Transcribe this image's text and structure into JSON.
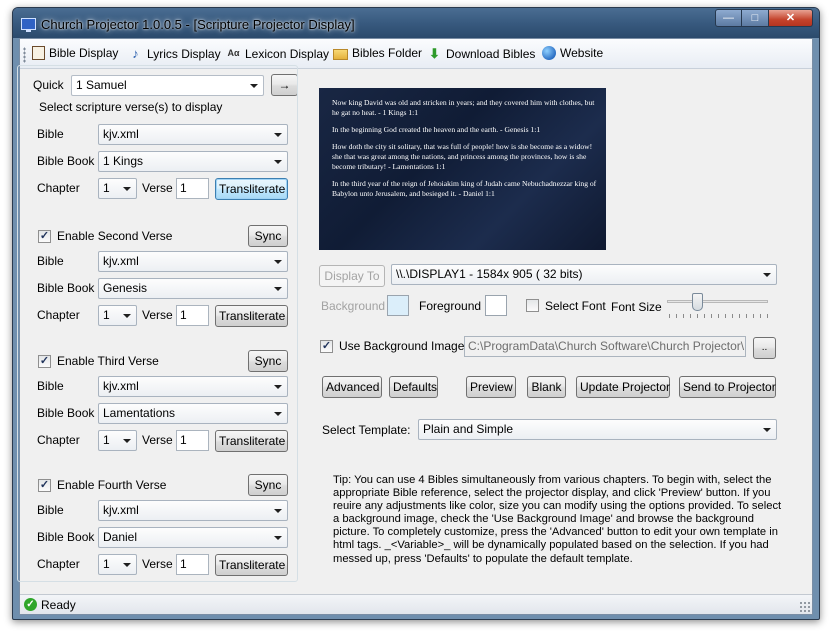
{
  "window": {
    "title": "Church Projector 1.0.0.5 - [Scripture Projector Display]",
    "controls": {
      "minimize": "—",
      "maximize": "□",
      "close": "✕"
    }
  },
  "menu": [
    {
      "label": "Bible Display",
      "icon": "bible-icon"
    },
    {
      "label": "Lyrics Display",
      "icon": "music-note-icon"
    },
    {
      "label": "Lexicon Display",
      "icon": "lexicon-icon"
    },
    {
      "label": "Bibles Folder",
      "icon": "folder-icon"
    },
    {
      "label": "Download Bibles",
      "icon": "download-icon"
    },
    {
      "label": "Website",
      "icon": "globe-icon"
    }
  ],
  "quick": {
    "label": "Quick",
    "value": "1 Samuel",
    "go_button": "→"
  },
  "group_title": "Select scripture verse(s) to display",
  "labels": {
    "bible": "Bible",
    "bible_book": "Bible Book",
    "chapter": "Chapter",
    "verse": "Verse"
  },
  "verses": [
    {
      "enable_label": "",
      "enabled": true,
      "bible": "kjv.xml",
      "book": "1 Kings",
      "chapter": "1",
      "verse": "1",
      "transliterate": "Transliterate",
      "sync": ""
    },
    {
      "enable_label": "Enable Second Verse",
      "enabled": true,
      "bible": "kjv.xml",
      "book": "Genesis",
      "chapter": "1",
      "verse": "1",
      "transliterate": "Transliterate",
      "sync": "Sync"
    },
    {
      "enable_label": "Enable Third Verse",
      "enabled": true,
      "bible": "kjv.xml",
      "book": "Lamentations",
      "chapter": "1",
      "verse": "1",
      "transliterate": "Transliterate",
      "sync": "Sync"
    },
    {
      "enable_label": "Enable Fourth Verse",
      "enabled": true,
      "bible": "kjv.xml",
      "book": "Daniel",
      "chapter": "1",
      "verse": "1",
      "transliterate": "Transliterate",
      "sync": "Sync"
    }
  ],
  "preview": [
    "Now king David was old and stricken in years; and they covered him with clothes, but he gat no heat. - 1 Kings 1:1",
    "In the beginning God created the heaven and the earth. - Genesis 1:1",
    "How doth the city sit solitary, that was full of people! how is she become as a widow! she that was great among the nations, and princess among the provinces, how is she become tributary! - Lamentations 1:1",
    "In the third year of the reign of Jehoiakim king of Judah came Nebuchadnezzar king of Babylon unto Jerusalem, and besieged it. - Daniel 1:1"
  ],
  "display": {
    "button": "Display To",
    "value": "\\\\.\\DISPLAY1 -  1584x 905 ( 32 bits)"
  },
  "appearance": {
    "background_label": "Background",
    "foreground_label": "Foreground",
    "select_font_label": "Select Font",
    "font_size_label": "Font Size",
    "background_color": "#dbeefa",
    "foreground_color": "#ffffff",
    "font_size_level": 0.28
  },
  "background_image": {
    "checkbox_label": "Use Background Image",
    "path": "C:\\ProgramData\\Church Software\\Church Projector\\Backg",
    "browse": ".."
  },
  "actions": {
    "advanced": "Advanced",
    "defaults": "Defaults",
    "preview": "Preview",
    "blank": "Blank",
    "update": "Update Projector",
    "send": "Send to Projector"
  },
  "template": {
    "label": "Select Template:",
    "value": "Plain and Simple"
  },
  "tip": "Tip: You can use 4 Bibles simultaneously from various chapters. To begin with, select the appropriate Bible reference, select the projector display, and click 'Preview' button. If you reuire any adjustments like color, size you can modify using the options provided. To select a background image, check the 'Use Background Image' and browse the background picture. To completely customize, press the 'Advanced' button to edit your own template in html tags. _<Variable>_ will be dynamically populated based on the selection. If you had messed up, press 'Defaults' to populate the default template.",
  "status": {
    "text": "Ready",
    "icon": "checkmark-icon"
  }
}
